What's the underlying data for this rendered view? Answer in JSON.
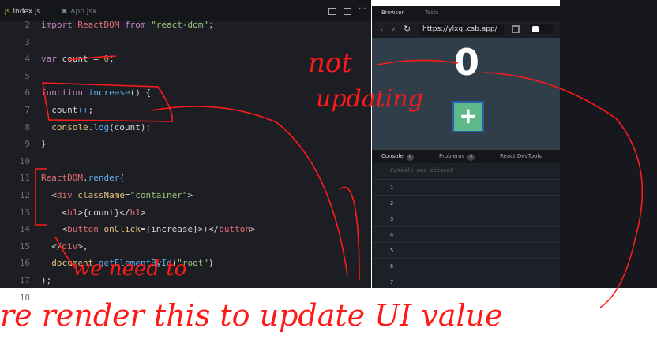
{
  "editor": {
    "tabs": [
      {
        "icon": "JS",
        "label": "index.js",
        "close": "×"
      },
      {
        "icon": "⚙",
        "label": "App.jsx"
      }
    ],
    "lines": [
      {
        "n": "2",
        "html": "<span class='kw'>import</span> <span class='tg'>ReactDOM</span> <span class='kw'>from</span> <span class='st'>\"react-dom\"</span>;"
      },
      {
        "n": "3",
        "html": ""
      },
      {
        "n": "4",
        "html": "<span class='kw'>var</span> count = <span class='nu'>0</span>;"
      },
      {
        "n": "5",
        "html": ""
      },
      {
        "n": "6",
        "html": "<span class='kw'>function</span> <span class='fn'>increase</span>() {"
      },
      {
        "n": "7",
        "html": "  count<span class='fn'>++</span>;"
      },
      {
        "n": "8",
        "html": "  <span class='va'>console</span>.<span class='fn'>log</span>(count);"
      },
      {
        "n": "9",
        "html": "}"
      },
      {
        "n": "10",
        "html": ""
      },
      {
        "n": "11",
        "html": "<span class='tg'>ReactDOM</span>.<span class='fn'>render</span>("
      },
      {
        "n": "12",
        "html": "  &lt;<span class='tg'>div</span> <span class='va'>className</span>=<span class='st'>\"container\"</span>&gt;"
      },
      {
        "n": "13",
        "html": "    &lt;<span class='tg'>h1</span>&gt;{count}&lt;/<span class='tg'>h1</span>&gt;"
      },
      {
        "n": "14",
        "html": "    &lt;<span class='tg'>button</span> <span class='va'>onClick</span>={increase}&gt;+&lt;/<span class='tg'>button</span>&gt;"
      },
      {
        "n": "15",
        "html": "  &lt;/<span class='tg'>div</span>&gt;,"
      },
      {
        "n": "16",
        "html": "  <span class='va'>document</span>.<span class='fn'>getElementById</span>(<span class='st'>\"root\"</span>)"
      },
      {
        "n": "17",
        "html": ");"
      },
      {
        "n": "18",
        "html": ""
      }
    ]
  },
  "browser": {
    "tabs": [
      "Browser",
      "Tests"
    ],
    "url": "https://ylxqj.csb.app/",
    "count": "0",
    "button": "+",
    "console_tabs": [
      {
        "label": "Console",
        "badge": "0"
      },
      {
        "label": "Problems",
        "badge": "0"
      },
      {
        "label": "React DevTools"
      }
    ],
    "cleared": "Console was cleared",
    "console_lines": [
      "1",
      "2",
      "3",
      "4",
      "5",
      "6",
      "7"
    ]
  },
  "annotations": {
    "a1": "not",
    "a2": "updating",
    "a3": "we need to",
    "a4": "re render this to update UI value"
  },
  "colors": {
    "annotation": "#ff1a1a",
    "preview_bg": "#2f3e48",
    "button": "#5fb88a"
  }
}
